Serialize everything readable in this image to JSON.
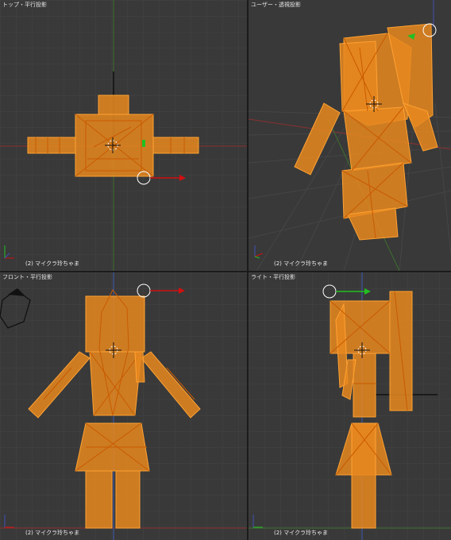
{
  "viewports": {
    "top": {
      "title": "トップ・平行投影",
      "object": "(2) マイクラ玲ちゃま"
    },
    "user": {
      "title": "ユーザー・透視投影",
      "object": "(2) マイクラ玲ちゃま"
    },
    "front": {
      "title": "フロント・平行投影",
      "object": "(2) マイクラ玲ちゃま"
    },
    "right": {
      "title": "ライト・平行投影",
      "object": "(2) マイクラ玲ちゃま"
    }
  },
  "colors": {
    "background": "#393939",
    "grid": "#444444",
    "mesh_fill": "#e8881f",
    "mesh_edge": "#ffa232",
    "mesh_wire": "#c95a00",
    "x_axis": "#c0392b",
    "y_axis": "#4a8f2d",
    "z_axis": "#3f51b5",
    "arrow_x": "#d01010",
    "arrow_y": "#22c022"
  },
  "icons": {
    "cursor": "3d-cursor-icon",
    "manipulator": "transform-manipulator-icon",
    "axes": "axis-gizmo-icon",
    "camera": "camera-icon"
  }
}
